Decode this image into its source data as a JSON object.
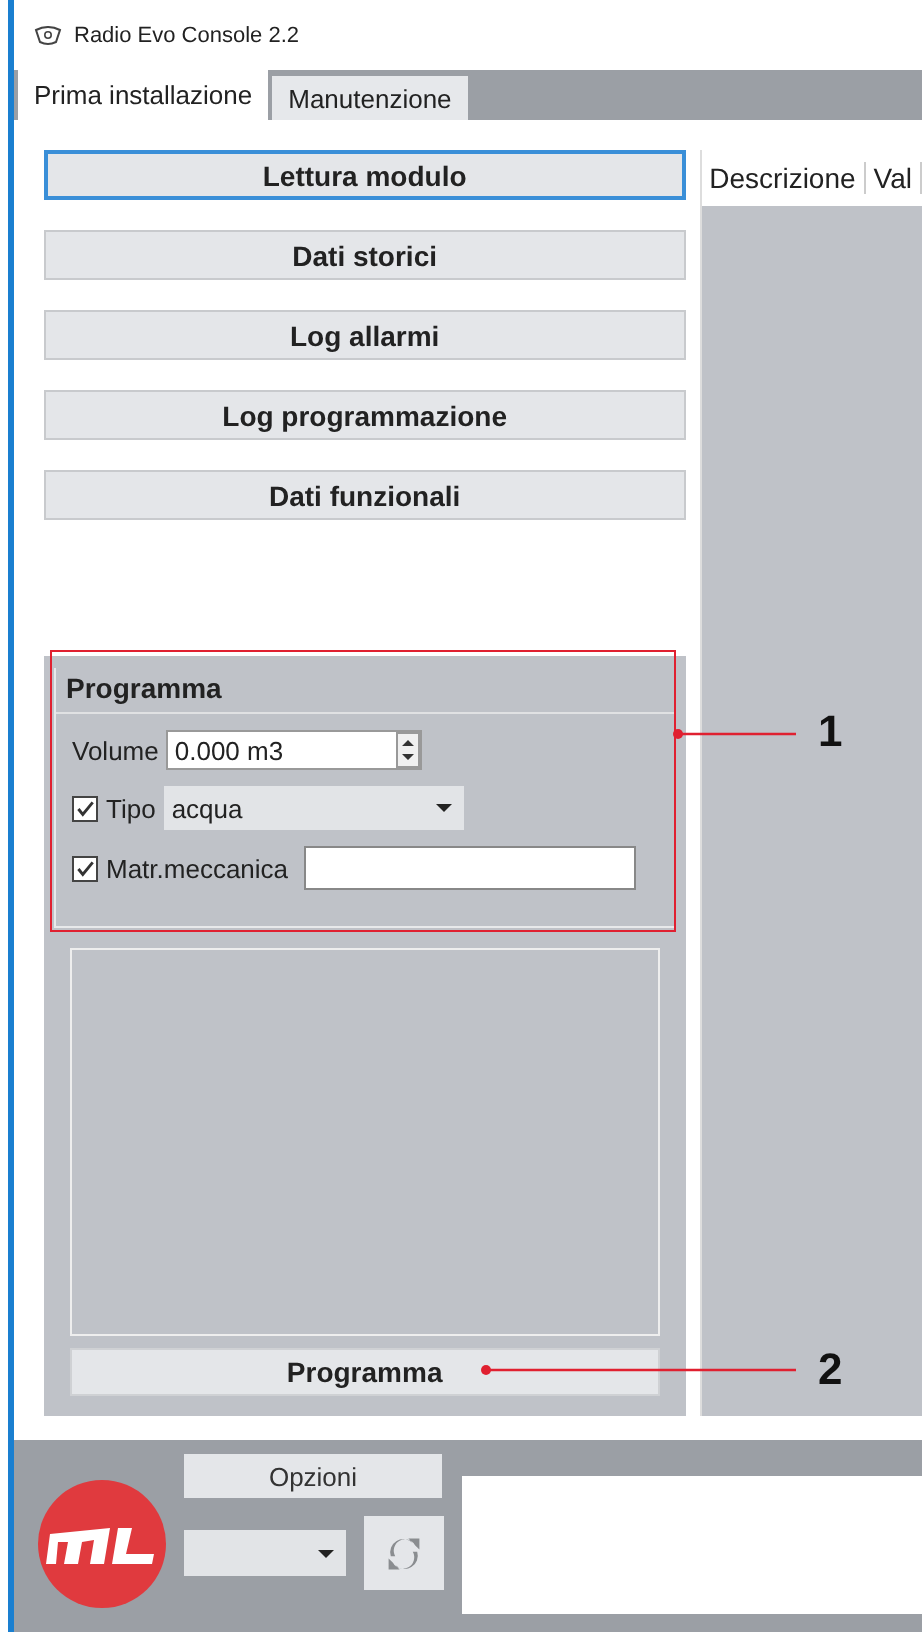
{
  "window": {
    "title": "Radio Evo Console 2.2"
  },
  "tabs": [
    {
      "label": "Prima installazione",
      "selected": true
    },
    {
      "label": "Manutenzione",
      "selected": false
    }
  ],
  "actions": [
    {
      "label": "Lettura modulo",
      "focused": true
    },
    {
      "label": "Dati storici",
      "focused": false
    },
    {
      "label": "Log allarmi",
      "focused": false
    },
    {
      "label": "Log programmazione",
      "focused": false
    },
    {
      "label": "Dati funzionali",
      "focused": false
    }
  ],
  "program_group": {
    "title": "Programma",
    "volume": {
      "label": "Volume",
      "value": "0.000 m3"
    },
    "tipo": {
      "label": "Tipo",
      "checked": true,
      "value": "acqua"
    },
    "matr": {
      "label": "Matr.meccanica",
      "checked": true
    }
  },
  "program_button": "Programma",
  "table": {
    "columns": [
      "Descrizione",
      "Val"
    ]
  },
  "bottom": {
    "options_button": "Opzioni"
  },
  "callouts": [
    "1",
    "2"
  ]
}
